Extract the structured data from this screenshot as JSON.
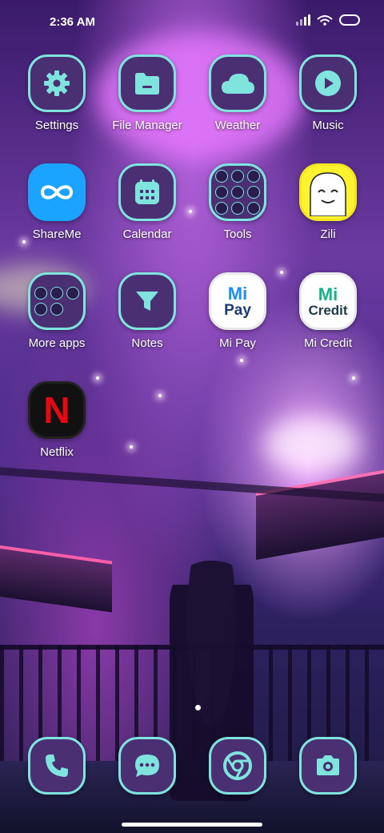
{
  "status": {
    "time": "2:36 AM"
  },
  "apps": {
    "settings": "Settings",
    "file_manager": "File Manager",
    "weather": "Weather",
    "music": "Music",
    "shareme": "ShareMe",
    "calendar": "Calendar",
    "tools": "Tools",
    "zili": "Zili",
    "more_apps": "More apps",
    "notes": "Notes",
    "mi_pay": "Mi Pay",
    "mi_credit": "Mi Credit",
    "netflix": "Netflix"
  },
  "icon_text": {
    "mi": "Mi",
    "pay": "Pay",
    "credit": "Credit",
    "netflix": "N"
  },
  "colors": {
    "accent": "#7fe4de",
    "tile": "#4a2f72"
  }
}
